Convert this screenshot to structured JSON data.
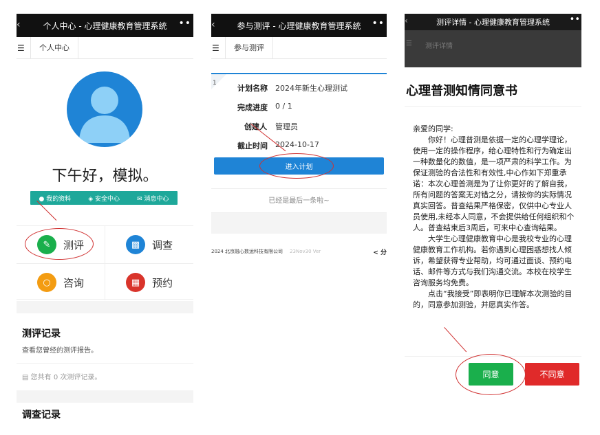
{
  "screen1": {
    "title": "个人中心 - 心理健康教育管理系统",
    "tab": "个人中心",
    "greeting": "下午好，模拟。",
    "quick_links": [
      "我的资料",
      "安全中心",
      "消息中心"
    ],
    "grid": {
      "assess": "测评",
      "survey": "调查",
      "consult": "咨询",
      "appointment": "预约"
    },
    "assessment_records": {
      "title": "测评记录",
      "subtitle": "查看您曾经的测评报告。",
      "count_text": "您共有 0 次测评记录。"
    },
    "survey_records": {
      "title": "调查记录"
    },
    "colors": {
      "avatar": "#1f84d6",
      "quick_bar": "#1ea89a",
      "assess": "#1aaf4c",
      "survey": "#1f84d6",
      "consult": "#f39c12",
      "appointment": "#d9342b"
    }
  },
  "screen2": {
    "title": "参与测评 - 心理健康教育管理系统",
    "tab": "参与测评",
    "card": {
      "index": "1",
      "plan_label": "计划名称",
      "plan_value": "2024年新生心理测试",
      "progress_label": "完成进度",
      "progress_value": "0 / 1",
      "creator_label": "创建人",
      "creator_value": "管理员",
      "deadline_label": "截止时间",
      "deadline_value": "2024-10-17",
      "enter_button": "进入计划"
    },
    "end_text": "已经是最后一条啦~",
    "footer_company": "2024 北京融心数运科技有限公司",
    "footer_version": "23Nov30 Ver",
    "footer_share": "分"
  },
  "screen3": {
    "title": "测评详情 - 心理健康教育管理系统",
    "tab": "测评详情",
    "modal": {
      "heading": "心理普测知情同意书",
      "salutation": "亲爱的同学:",
      "para1": "你好！心理普测是依据一定的心理学理论，使用一定的操作程序，给心理特性和行为确定出一种数量化的数值，是一项严肃的科学工作。为保证测验的合法性和有效性,中心作如下郑重承诺：本次心理普测是为了让你更好的了解自我，所有问题的答案无对错之分，请按你的实际情况真实回答。普查结果严格保密，仅供中心专业人员使用,未经本人同意，不会提供给任何组织和个人。普查结束后3周后，可来中心查询结果。",
      "para2": "大学生心理健康教育中心是我校专业的心理健康教育工作机构。若你遇到心理困惑想找人倾诉，希望获得专业帮助，均可通过面谈、预约电话、邮件等方式与我们沟通交流。本校在校学生咨询服务均免费。",
      "para3": "点击“我接受”即表明你已理解本次测验的目的，同意参加测验，并愿真实作答。",
      "agree_button": "同意",
      "disagree_button": "不同意"
    }
  }
}
